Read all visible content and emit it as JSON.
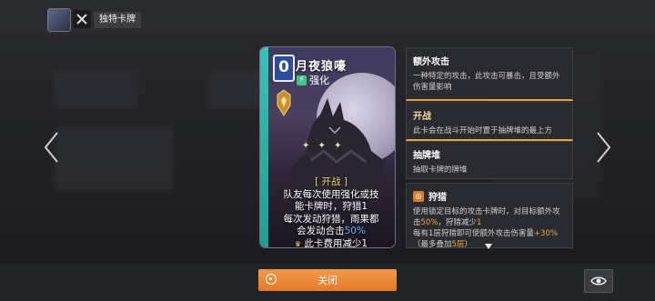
{
  "header": {
    "title": "独特卡牌"
  },
  "card": {
    "cost": "0",
    "name": "月夜狼嚎",
    "type": "强化",
    "text_line1": "[ 开战 ]",
    "text_line2": "队友每次使用强化或技",
    "text_line3": "能卡牌时，狩猎1",
    "text_line4": "每次发动狩猎，雨果都",
    "text_line5a": "会发动合击",
    "text_line5b": "50%",
    "text_line6": "此卡费用减少1"
  },
  "info_panels": [
    {
      "title": "额外攻击",
      "body": "一种特定的攻击，此攻击可暴击，且受额外伤害量影响"
    },
    {
      "title": "开战",
      "body": "此卡会在战斗开始时置于抽牌堆的最上方"
    },
    {
      "title": "抽牌堆",
      "body": "抽取卡牌的牌堆"
    },
    {
      "title": "狩猎",
      "body_a": "使用锁定目标的攻击卡牌时，对目标额外攻击",
      "body_b": "50%",
      "body_c": "，狩猎减少",
      "body_d": "1",
      "body_e": "每有1层狩猎即可使额外攻击伤害量",
      "body_f": "+30%",
      "body_g": "（最多叠加",
      "body_h": "5层",
      "body_i": "）"
    }
  ],
  "buttons": {
    "close_label": "关闭"
  },
  "colors": {
    "accent_orange": "#e8862f",
    "card_strip": "#2fb9aa",
    "highlight_blue": "#5fb9ff",
    "highlight_orange": "#f0a33b"
  }
}
